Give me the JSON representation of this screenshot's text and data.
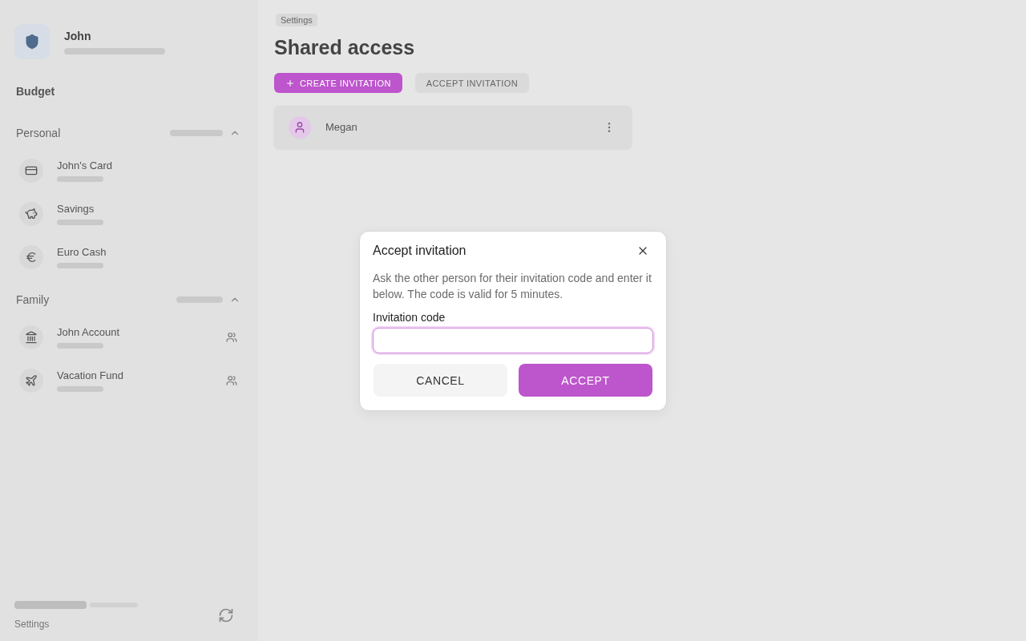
{
  "sidebar": {
    "user": {
      "name": "John"
    },
    "title": "Budget",
    "groups": [
      {
        "name": "Personal",
        "accounts": [
          {
            "name": "John's Card",
            "kind": "card",
            "shared": false
          },
          {
            "name": "Savings",
            "kind": "savings",
            "shared": false
          },
          {
            "name": "Euro Cash",
            "kind": "euro",
            "shared": false
          }
        ]
      },
      {
        "name": "Family",
        "accounts": [
          {
            "name": "John Account",
            "kind": "bank",
            "shared": true
          },
          {
            "name": "Vacation Fund",
            "kind": "travel",
            "shared": true
          }
        ]
      }
    ],
    "footer": {
      "link": "Settings"
    }
  },
  "main": {
    "breadcrumb": "Settings",
    "title": "Shared access",
    "actions": [
      {
        "label": "CREATE INVITATION",
        "kind": "primary"
      },
      {
        "label": "ACCEPT INVITATION",
        "kind": "secondary"
      }
    ],
    "members": [
      {
        "name": "Megan"
      }
    ]
  },
  "dialog": {
    "title": "Accept invitation",
    "description": "Ask the other person for their invitation code and enter it below. The code is valid for 5 minutes.",
    "field": {
      "label": "Invitation code",
      "focused": true
    },
    "buttons": [
      {
        "label": "CANCEL",
        "kind": "secondary"
      },
      {
        "label": "ACCEPT",
        "kind": "primary"
      }
    ]
  }
}
